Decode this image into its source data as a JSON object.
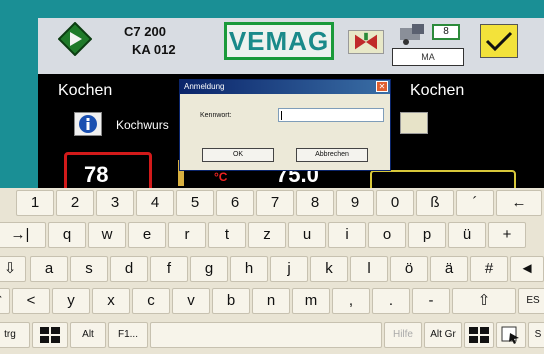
{
  "topbar": {
    "code_line1": "C7 200",
    "code_line2": "KA 012",
    "logo": "VEMAG",
    "badge": "8",
    "ma_label": "MA",
    "icons": [
      "diamond-start-icon",
      "valve-icon",
      "machine-icon",
      "checkmark-icon"
    ]
  },
  "main": {
    "left_heading": "Kochen",
    "right_heading": "Kochen",
    "program_label": "Kochwurs",
    "value_left": "78",
    "unit": "°C",
    "value_center": "75.0"
  },
  "dialog": {
    "title": "Anmeldung",
    "password_label": "Kennwort:",
    "password_value": "",
    "ok_label": "OK",
    "cancel_label": "Abbrechen"
  },
  "keyboard": {
    "row1": [
      "1",
      "2",
      "3",
      "4",
      "5",
      "6",
      "7",
      "8",
      "9",
      "0",
      "ß",
      "´",
      "←"
    ],
    "row2": [
      "→|",
      "q",
      "w",
      "e",
      "r",
      "t",
      "z",
      "u",
      "i",
      "o",
      "p",
      "ü",
      "+"
    ],
    "row3": [
      "⇩",
      "a",
      "s",
      "d",
      "f",
      "g",
      "h",
      "j",
      "k",
      "l",
      "ö",
      "ä",
      "#",
      "◄"
    ],
    "row4": [
      "⇧",
      "<",
      "y",
      "x",
      "c",
      "v",
      "b",
      "n",
      "m",
      ",",
      ".",
      "-",
      "⇧",
      "ES"
    ],
    "row5": [
      "trg",
      "",
      "Alt",
      "F1...",
      "Hilfe",
      "Alt Gr",
      "",
      "",
      "S"
    ]
  }
}
